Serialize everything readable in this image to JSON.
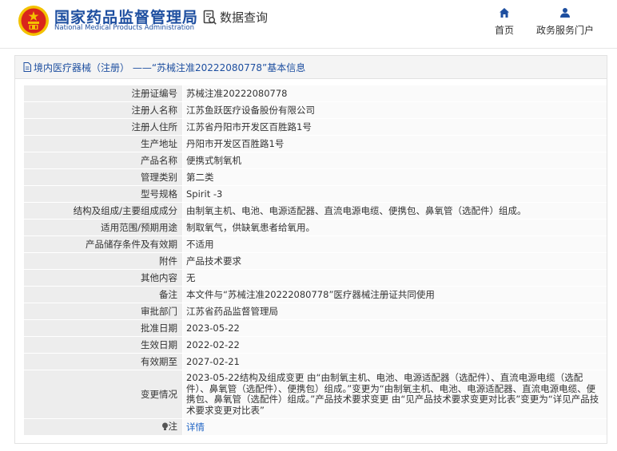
{
  "header": {
    "brand_cn": "国家药品监督管理局",
    "brand_en": "National Medical Products Administration",
    "query_label": "数据查询",
    "nav": [
      {
        "label": "首页",
        "icon": "home-icon"
      },
      {
        "label": "政务服务门户",
        "icon": "user-icon"
      }
    ]
  },
  "panel": {
    "title": "境内医疗器械（注册） ——“苏械注准20222080778”基本信息"
  },
  "rows": [
    {
      "label": "注册证编号",
      "value": "苏械注准20222080778"
    },
    {
      "label": "注册人名称",
      "value": "江苏鱼跃医疗设备股份有限公司"
    },
    {
      "label": "注册人住所",
      "value": "江苏省丹阳市开发区百胜路1号"
    },
    {
      "label": "生产地址",
      "value": "丹阳市开发区百胜路1号"
    },
    {
      "label": "产品名称",
      "value": "便携式制氧机"
    },
    {
      "label": "管理类别",
      "value": "第二类"
    },
    {
      "label": "型号规格",
      "value": "Spirit -3"
    },
    {
      "label": "结构及组成/主要组成成分",
      "value": "由制氧主机、电池、电源适配器、直流电源电缆、便携包、鼻氧管（选配件）组成。"
    },
    {
      "label": "适用范围/预期用途",
      "value": "制取氧气，供缺氧患者给氧用。"
    },
    {
      "label": "产品储存条件及有效期",
      "value": "不适用"
    },
    {
      "label": "附件",
      "value": "产品技术要求"
    },
    {
      "label": "其他内容",
      "value": "无"
    },
    {
      "label": "备注",
      "value": "本文件与“苏械注准20222080778”医疗器械注册证共同使用"
    },
    {
      "label": "审批部门",
      "value": "江苏省药品监督管理局"
    },
    {
      "label": "批准日期",
      "value": "2023-05-22"
    },
    {
      "label": "生效日期",
      "value": "2022-02-22"
    },
    {
      "label": "有效期至",
      "value": "2027-02-21"
    },
    {
      "label": "变更情况",
      "value": "2023-05-22结构及组成变更 由“由制氧主机、电池、电源适配器（选配件）、直流电源电缆（选配件）、鼻氧管（选配件）、便携包）组成。”变更为“由制氧主机、电池、电源适配器、直流电源电缆、便携包、鼻氧管（选配件）组成。”产品技术要求变更 由“见产品技术要求变更对比表”变更为“详见产品技术要求变更对比表”"
    }
  ],
  "note_row": {
    "label": "注",
    "link": "详情"
  },
  "colors": {
    "brand_blue": "#1e4fa0",
    "link_blue": "#1e63c4",
    "label_bg": "#ededed",
    "emblem_red": "#d9251c",
    "emblem_gold": "#f3c200"
  }
}
